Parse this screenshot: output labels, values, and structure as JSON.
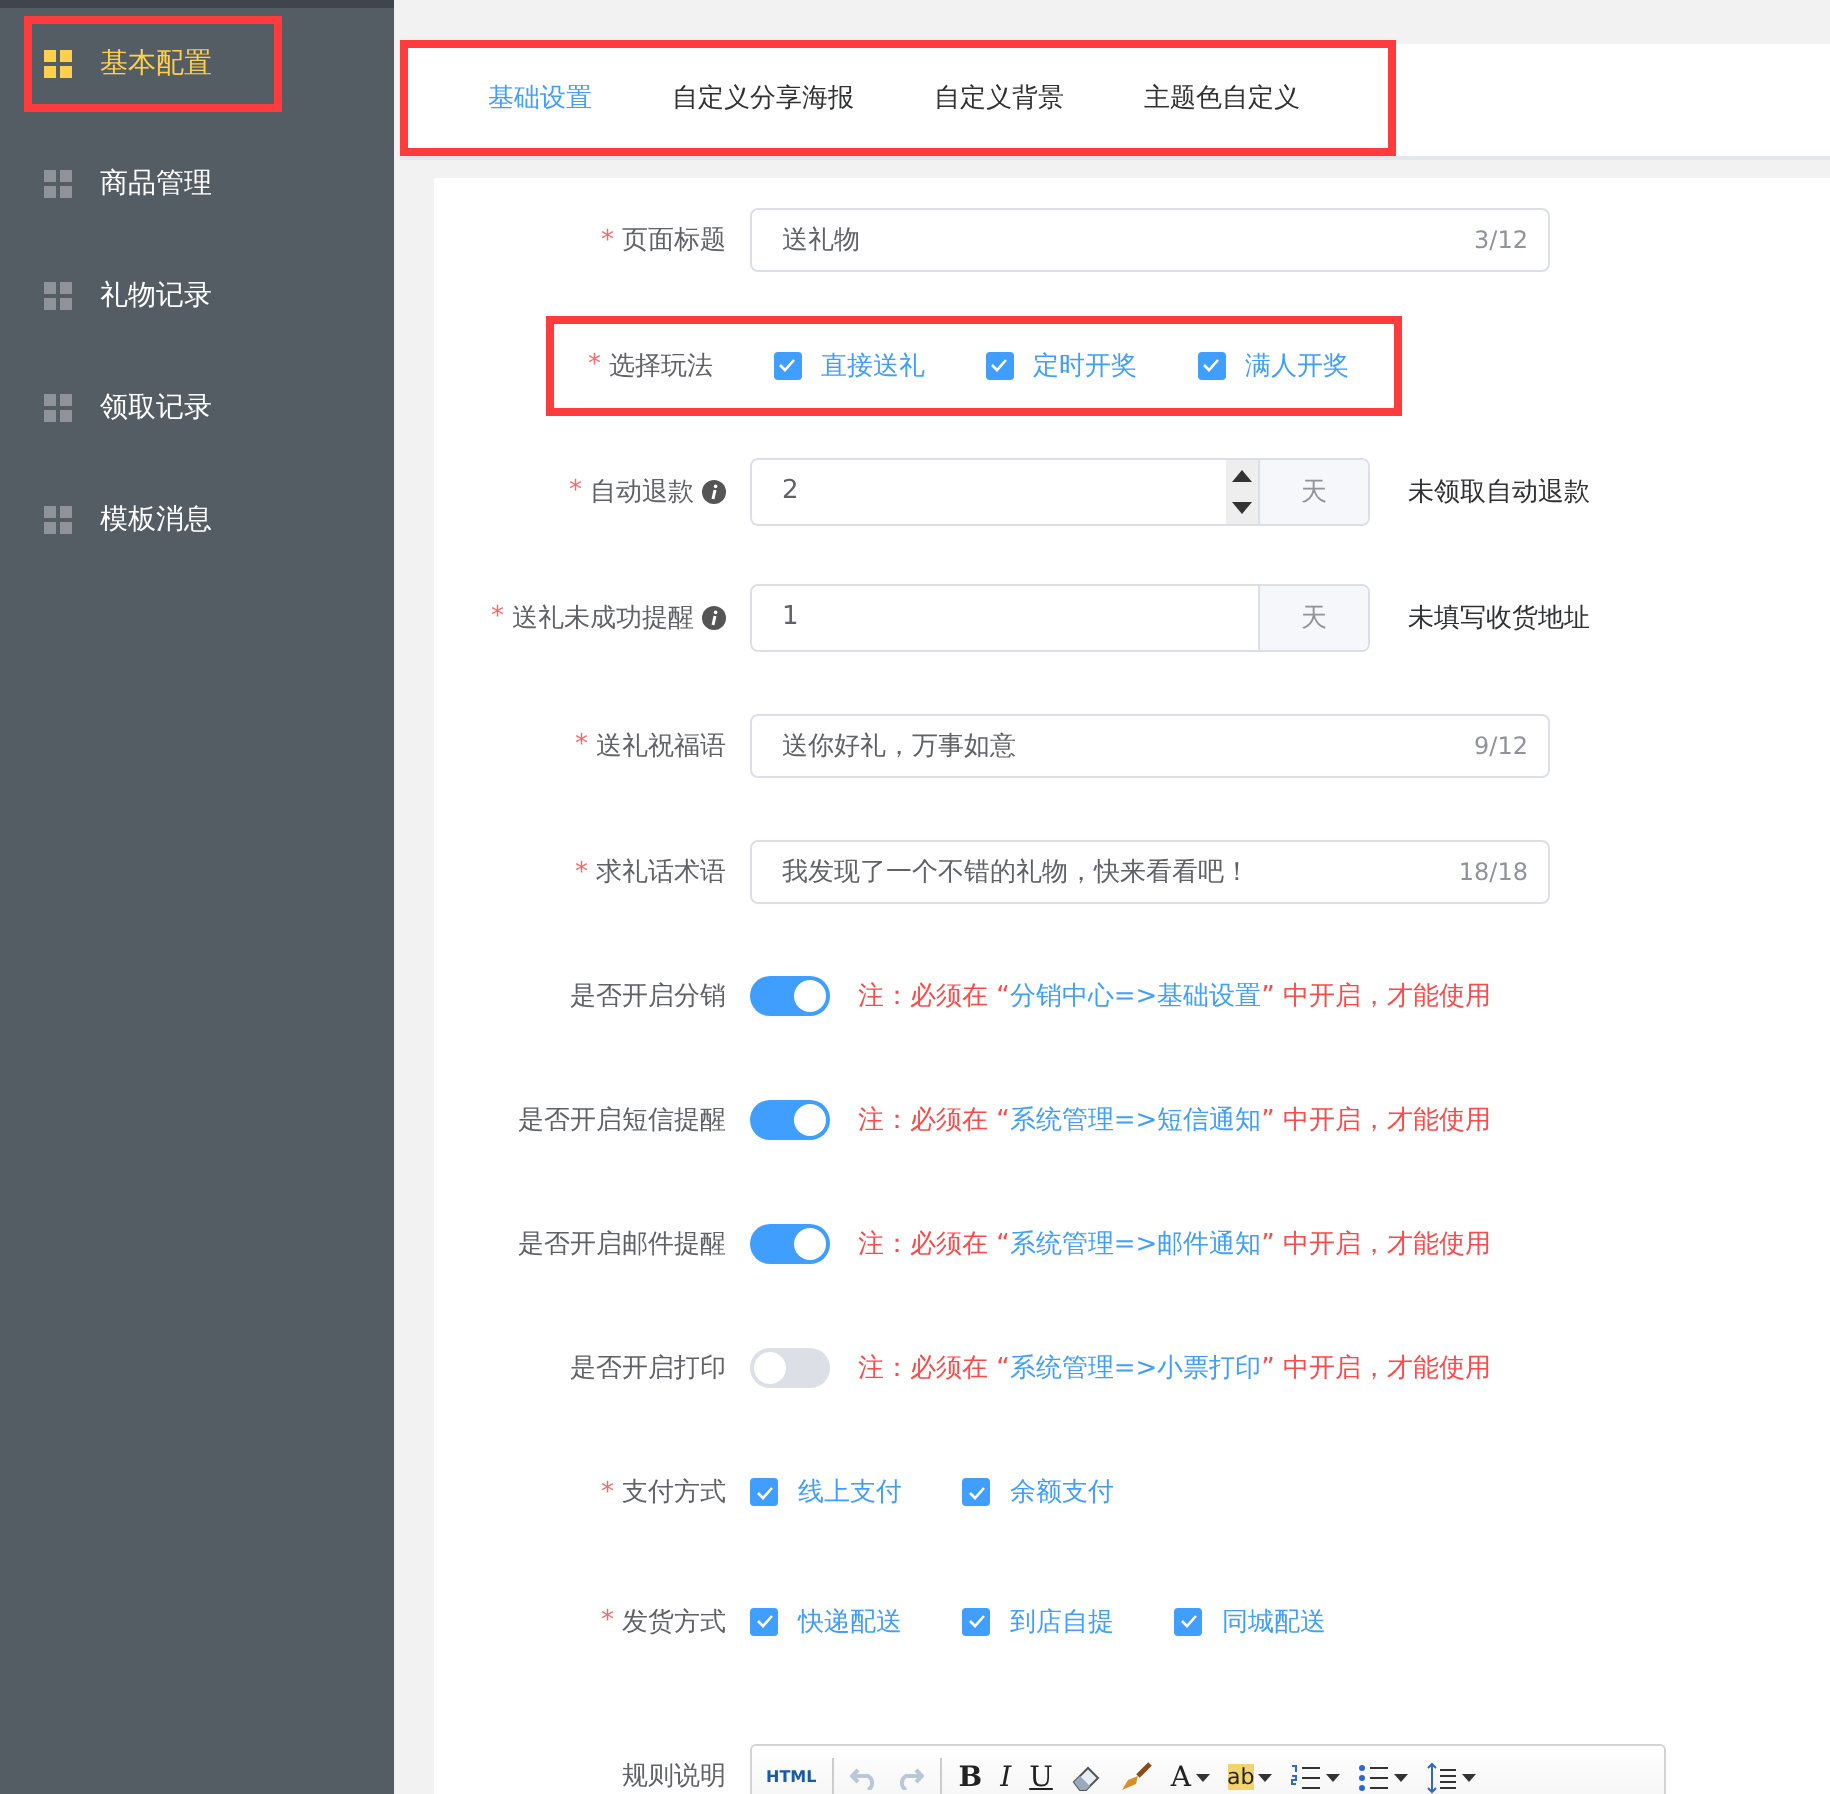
{
  "sidebar": {
    "items": [
      {
        "label": "基本配置",
        "selected": true,
        "highlighted": true
      },
      {
        "label": "商品管理",
        "selected": false,
        "highlighted": false
      },
      {
        "label": "礼物记录",
        "selected": false,
        "highlighted": false
      },
      {
        "label": "领取记录",
        "selected": false,
        "highlighted": false
      },
      {
        "label": "模板消息",
        "selected": false,
        "highlighted": false
      }
    ]
  },
  "tabs": {
    "highlighted": true,
    "items": [
      {
        "label": "基础设置",
        "selected": true
      },
      {
        "label": "自定义分享海报",
        "selected": false
      },
      {
        "label": "自定义背景",
        "selected": false
      },
      {
        "label": "主题色自定义",
        "selected": false
      }
    ]
  },
  "form": [
    {
      "kind": "text",
      "label": "页面标题",
      "mark": "*",
      "value": "送礼物",
      "counter": "3/12"
    },
    {
      "kind": "checkboxes",
      "label": "选择玩法",
      "mark": "*",
      "highlighted": true,
      "options": [
        {
          "label": "直接送礼",
          "checked": true
        },
        {
          "label": "定时开奖",
          "checked": true
        },
        {
          "label": "满人开奖",
          "checked": true
        }
      ]
    },
    {
      "kind": "number",
      "label": "自动退款",
      "mark": "*",
      "info": true,
      "value": "2",
      "spinner": true,
      "unit": "天",
      "hint": "未领取自动退款"
    },
    {
      "kind": "number",
      "label": "送礼未成功提醒",
      "mark": "*",
      "info": true,
      "value": "1",
      "spinner": false,
      "unit": "天",
      "hint": "未填写收货地址"
    },
    {
      "kind": "text",
      "label": "送礼祝福语",
      "mark": "*",
      "value": "送你好礼，万事如意",
      "counter": "9/12"
    },
    {
      "kind": "text",
      "label": "求礼话术语",
      "mark": "*",
      "value": "我发现了一个不错的礼物，快来看看吧！",
      "counter": "18/18"
    },
    {
      "kind": "switch",
      "label": "是否开启分销",
      "on": true,
      "note": {
        "prefix": "注：必须在 “",
        "link": "分销中心=>基础设置",
        "suffix": "” 中开启，才能使用"
      }
    },
    {
      "kind": "switch",
      "label": "是否开启短信提醒",
      "on": true,
      "note": {
        "prefix": "注：必须在 “",
        "link": "系统管理=>短信通知",
        "suffix": "” 中开启，才能使用"
      }
    },
    {
      "kind": "switch",
      "label": "是否开启邮件提醒",
      "on": true,
      "note": {
        "prefix": "注：必须在 “",
        "link": "系统管理=>邮件通知",
        "suffix": "” 中开启，才能使用"
      }
    },
    {
      "kind": "switch",
      "label": "是否开启打印",
      "on": false,
      "note": {
        "prefix": "注：必须在 “",
        "link": "系统管理=>小票打印",
        "suffix": "” 中开启，才能使用"
      }
    },
    {
      "kind": "checkboxes",
      "label": "支付方式",
      "mark": "*",
      "highlighted": false,
      "options": [
        {
          "label": "线上支付",
          "checked": true
        },
        {
          "label": "余额支付",
          "checked": true
        }
      ]
    },
    {
      "kind": "checkboxes",
      "label": "发货方式",
      "mark": "*",
      "highlighted": false,
      "options": [
        {
          "label": "快递配送",
          "checked": true
        },
        {
          "label": "到店自提",
          "checked": true
        },
        {
          "label": "同城配送",
          "checked": true
        }
      ]
    },
    {
      "kind": "editor",
      "label": "规则说明",
      "toolbar": [
        {
          "kind": "html",
          "text": "HTML",
          "disabled": false,
          "dropdown": false
        },
        {
          "kind": "sep"
        },
        {
          "kind": "undo",
          "disabled": true,
          "dropdown": false
        },
        {
          "kind": "redo",
          "disabled": true,
          "dropdown": false
        },
        {
          "kind": "sep"
        },
        {
          "kind": "bold",
          "text": "B",
          "disabled": false,
          "dropdown": false
        },
        {
          "kind": "italic",
          "text": "I",
          "disabled": false,
          "dropdown": false
        },
        {
          "kind": "underline",
          "text": "U",
          "disabled": false,
          "dropdown": false
        },
        {
          "kind": "eraser",
          "disabled": false,
          "dropdown": false
        },
        {
          "kind": "brush",
          "disabled": false,
          "dropdown": false
        },
        {
          "kind": "fontcolor",
          "text": "A",
          "disabled": false,
          "dropdown": true
        },
        {
          "kind": "highlight",
          "text": "ab",
          "disabled": false,
          "dropdown": true
        },
        {
          "kind": "olist",
          "disabled": false,
          "dropdown": true
        },
        {
          "kind": "ulist",
          "disabled": false,
          "dropdown": true
        },
        {
          "kind": "lineheight",
          "disabled": false,
          "dropdown": true
        }
      ]
    }
  ]
}
